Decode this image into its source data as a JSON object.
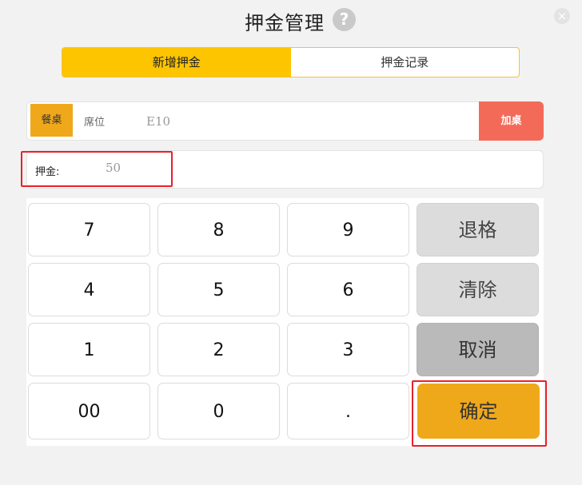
{
  "header": {
    "title": "押金管理",
    "help_icon": "?",
    "close_icon": "×"
  },
  "tabs": [
    {
      "label": "新增押金",
      "active": true
    },
    {
      "label": "押金记录",
      "active": false
    }
  ],
  "table_row": {
    "tag": "餐桌",
    "seat_label": "席位",
    "seat_value": "E10",
    "add_button": "加桌"
  },
  "deposit": {
    "label": "押金:",
    "value": "50"
  },
  "keypad": {
    "keys": [
      "7",
      "8",
      "9",
      "4",
      "5",
      "6",
      "1",
      "2",
      "3",
      "00",
      "0",
      "."
    ],
    "backspace": "退格",
    "clear": "清除",
    "cancel": "取消",
    "confirm": "确定"
  },
  "colors": {
    "accent": "#fdc400",
    "confirm": "#f0a81b",
    "add_button": "#f46a59",
    "highlight": "#e8202a"
  }
}
